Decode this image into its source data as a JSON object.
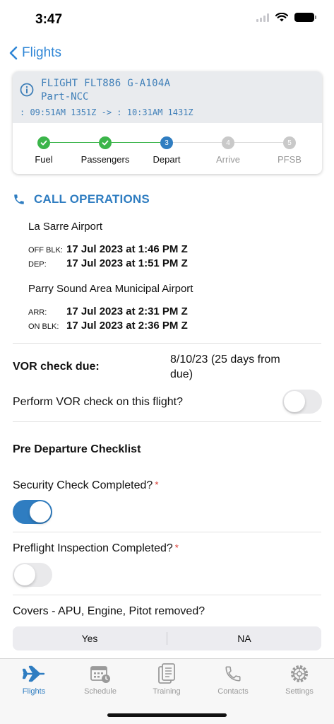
{
  "status": {
    "time": "3:47"
  },
  "nav": {
    "back_label": "Flights"
  },
  "flight": {
    "title": "FLIGHT FLT886 G-A104A",
    "rule": "Part-NCC",
    "times": ": 09:51AM 1351Z -> : 10:31AM 1431Z"
  },
  "steps": [
    {
      "label": "Fuel",
      "state": "done",
      "marker": ""
    },
    {
      "label": "Passengers",
      "state": "done",
      "marker": ""
    },
    {
      "label": "Depart",
      "state": "current",
      "marker": "3"
    },
    {
      "label": "Arrive",
      "state": "pending",
      "marker": "4"
    },
    {
      "label": "PFSB",
      "state": "pending",
      "marker": "5"
    }
  ],
  "call_ops": {
    "label": "CALL OPERATIONS"
  },
  "departure": {
    "airport": "La Sarre Airport",
    "off_blk_key": "OFF BLK:",
    "off_blk": "17 Jul 2023 at 1:46 PM Z",
    "dep_key": "DEP:",
    "dep": "17 Jul 2023 at 1:51 PM Z"
  },
  "arrival": {
    "airport": "Parry Sound Area Municipal Airport",
    "arr_key": "ARR:",
    "arr": "17 Jul 2023 at 2:31 PM Z",
    "on_blk_key": "ON BLK:",
    "on_blk": "17 Jul 2023 at 2:36 PM Z"
  },
  "vor": {
    "label": "VOR check due:",
    "value": "8/10/23 (25 days from due)",
    "perform_label": "Perform VOR check on this flight?",
    "perform_on": false
  },
  "checklist": {
    "title": "Pre Departure Checklist",
    "security_label": "Security Check Completed?",
    "security_on": true,
    "preflight_label": "Preflight Inspection Completed?",
    "preflight_on": false,
    "required_mark": "*",
    "covers_label": "Covers - APU, Engine, Pitot removed?",
    "covers_options": [
      "Yes",
      "NA"
    ]
  },
  "tabs": [
    {
      "label": "Flights",
      "icon": "plane-icon",
      "active": true
    },
    {
      "label": "Schedule",
      "icon": "calendar-clock-icon",
      "active": false
    },
    {
      "label": "Training",
      "icon": "documents-icon",
      "active": false
    },
    {
      "label": "Contacts",
      "icon": "phone-icon",
      "active": false
    },
    {
      "label": "Settings",
      "icon": "gear-icon",
      "active": false
    }
  ],
  "colors": {
    "accent": "#2f7dc1",
    "done": "#3bb54a",
    "pending": "#c9c9c9",
    "required": "#d9342b"
  }
}
